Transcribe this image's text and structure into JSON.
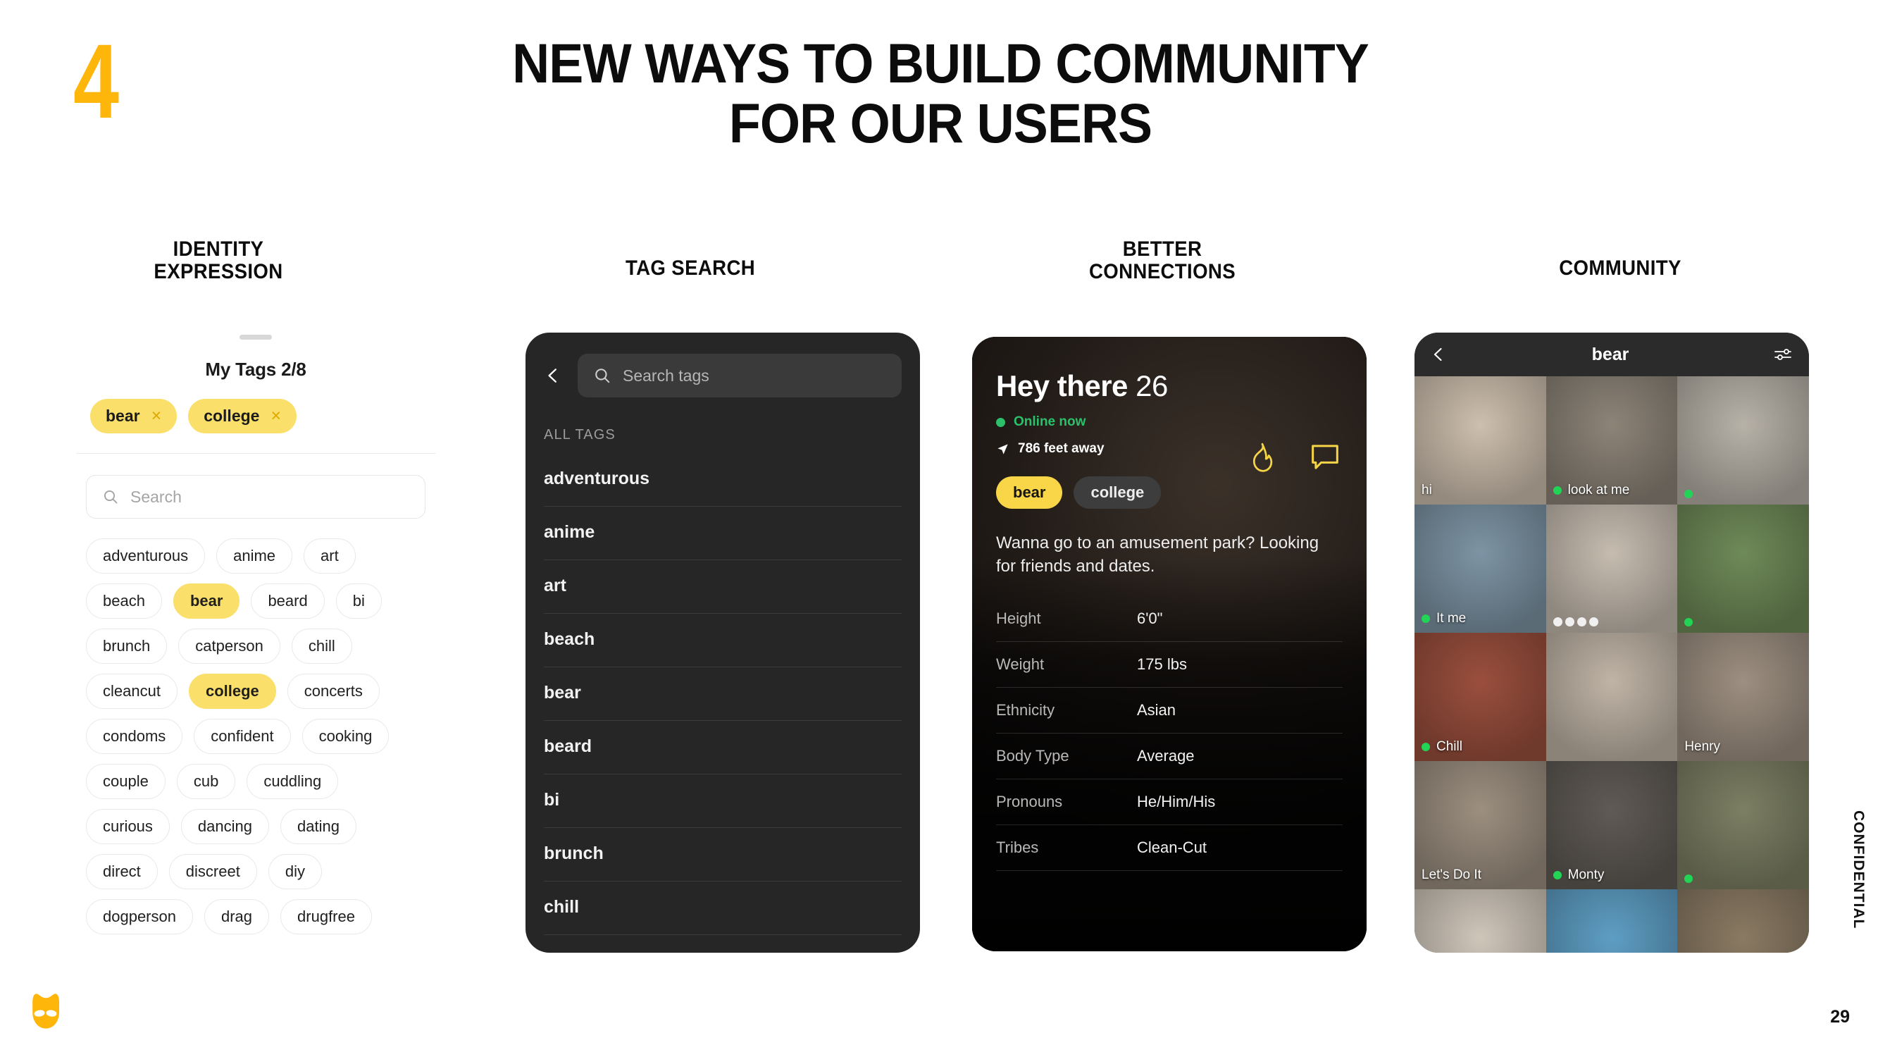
{
  "slide": {
    "number": "4",
    "headline_line1": "NEW WAYS TO BUILD COMMUNITY",
    "headline_line2": "FOR OUR USERS",
    "confidential": "CONFIDENTIAL",
    "page_number": "29",
    "accent_yellow": "#FFB60A",
    "chip_yellow": "#FAE06B",
    "online_green": "#2CC06B"
  },
  "columns": {
    "identity": "IDENTITY\nEXPRESSION",
    "tag_search": "TAG SEARCH",
    "better_connections": "BETTER\nCONNECTIONS",
    "community": "COMMUNITY"
  },
  "identity_panel": {
    "my_tags_title": "My Tags 2/8",
    "selected_tags": [
      {
        "label": "bear",
        "remove": "×"
      },
      {
        "label": "college",
        "remove": "×"
      }
    ],
    "search_placeholder": "Search",
    "search_value": "",
    "chips": [
      {
        "label": "adventurous",
        "selected": false
      },
      {
        "label": "anime",
        "selected": false
      },
      {
        "label": "art",
        "selected": false
      },
      {
        "label": "beach",
        "selected": false
      },
      {
        "label": "bear",
        "selected": true
      },
      {
        "label": "beard",
        "selected": false
      },
      {
        "label": "bi",
        "selected": false
      },
      {
        "label": "brunch",
        "selected": false
      },
      {
        "label": "catperson",
        "selected": false
      },
      {
        "label": "chill",
        "selected": false
      },
      {
        "label": "cleancut",
        "selected": false
      },
      {
        "label": "college",
        "selected": true
      },
      {
        "label": "concerts",
        "selected": false
      },
      {
        "label": "condoms",
        "selected": false
      },
      {
        "label": "confident",
        "selected": false
      },
      {
        "label": "cooking",
        "selected": false
      },
      {
        "label": "couple",
        "selected": false
      },
      {
        "label": "cub",
        "selected": false
      },
      {
        "label": "cuddling",
        "selected": false
      },
      {
        "label": "curious",
        "selected": false
      },
      {
        "label": "dancing",
        "selected": false
      },
      {
        "label": "dating",
        "selected": false
      },
      {
        "label": "direct",
        "selected": false
      },
      {
        "label": "discreet",
        "selected": false
      },
      {
        "label": "diy",
        "selected": false
      },
      {
        "label": "dogperson",
        "selected": false
      },
      {
        "label": "drag",
        "selected": false
      },
      {
        "label": "drugfree",
        "selected": false
      }
    ]
  },
  "tag_search_panel": {
    "search_placeholder": "Search tags",
    "search_value": "",
    "section_label": "ALL TAGS",
    "items": [
      "adventurous",
      "anime",
      "art",
      "beach",
      "bear",
      "beard",
      "bi",
      "brunch",
      "chill"
    ]
  },
  "profile_panel": {
    "name": "Hey there",
    "age": "26",
    "status": "Online now",
    "distance": "786 feet away",
    "tags": [
      {
        "label": "bear",
        "highlight": true
      },
      {
        "label": "college",
        "highlight": false
      }
    ],
    "about": "Wanna go to an amusement park? Looking for friends and dates.",
    "details": [
      {
        "key": "Height",
        "value": "6'0\""
      },
      {
        "key": "Weight",
        "value": "175 lbs"
      },
      {
        "key": "Ethnicity",
        "value": "Asian"
      },
      {
        "key": "Body Type",
        "value": "Average"
      },
      {
        "key": "Pronouns",
        "value": "He/Him/His"
      },
      {
        "key": "Tribes",
        "value": "Clean-Cut"
      }
    ]
  },
  "community_panel": {
    "title": "bear",
    "tiles": [
      {
        "label": "hi",
        "online": false,
        "typing": false,
        "tone": "#cdbfae"
      },
      {
        "label": "look at me",
        "online": true,
        "typing": false,
        "tone": "#8d8478"
      },
      {
        "label": "",
        "online": true,
        "typing": false,
        "tone": "#b7b2a8"
      },
      {
        "label": "It me",
        "online": true,
        "typing": false,
        "tone": "#7d94a4"
      },
      {
        "label": "",
        "online": false,
        "typing": true,
        "tone": "#c6bcb0"
      },
      {
        "label": "",
        "online": true,
        "typing": false,
        "tone": "#6f8a58"
      },
      {
        "label": "Chill",
        "online": true,
        "typing": false,
        "tone": "#9a4f3d"
      },
      {
        "label": "",
        "online": false,
        "typing": false,
        "tone": "#c0b4a6"
      },
      {
        "label": "Henry",
        "online": false,
        "typing": false,
        "tone": "#9d8f81"
      },
      {
        "label": "Let's Do It",
        "online": false,
        "typing": false,
        "tone": "#9c8f80"
      },
      {
        "label": "Monty",
        "online": true,
        "typing": false,
        "tone": "#5f5a55"
      },
      {
        "label": "",
        "online": true,
        "typing": false,
        "tone": "#7c7f63"
      },
      {
        "label": "",
        "online": false,
        "typing": false,
        "tone": "#cfc6ba"
      },
      {
        "label": "",
        "online": false,
        "typing": false,
        "tone": "#5e9ec4"
      },
      {
        "label": "",
        "online": false,
        "typing": false,
        "tone": "#8a7a63"
      }
    ]
  },
  "icons": {
    "search": "search-icon",
    "back": "back-chevron-icon",
    "filter": "filter-sliders-icon",
    "flame": "flame-icon",
    "chat": "chat-bubble-icon",
    "location": "location-arrow-icon",
    "logo": "grindr-mask-logo"
  }
}
